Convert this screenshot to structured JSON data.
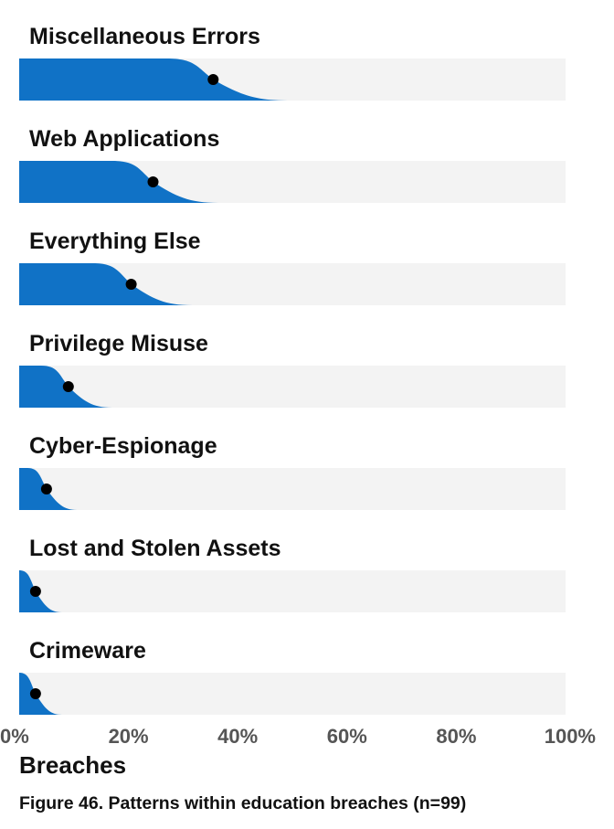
{
  "chart_data": {
    "type": "area",
    "x_axis": {
      "label": "Breaches",
      "ticks": [
        "0%",
        "20%",
        "40%",
        "60%",
        "80%",
        "100%"
      ],
      "range": [
        0,
        100
      ]
    },
    "rows": [
      {
        "name": "Miscellaneous Errors",
        "point": 35.5,
        "spread": 8.5
      },
      {
        "name": "Web Applications",
        "point": 24.5,
        "spread": 7.5
      },
      {
        "name": "Everything Else",
        "point": 20.5,
        "spread": 7.0
      },
      {
        "name": "Privilege Misuse",
        "point": 9.0,
        "spread": 5.0
      },
      {
        "name": "Cyber-Espionage",
        "point": 5.0,
        "spread": 3.5
      },
      {
        "name": "Lost and Stolen Assets",
        "point": 3.0,
        "spread": 3.0
      },
      {
        "name": "Crimeware",
        "point": 3.0,
        "spread": 3.0
      }
    ],
    "grid": false,
    "colors": {
      "fill": "#1072c6",
      "track": "#f3f3f3",
      "point": "#000000"
    }
  },
  "caption": "Figure 46. Patterns within education breaches (n=99)"
}
